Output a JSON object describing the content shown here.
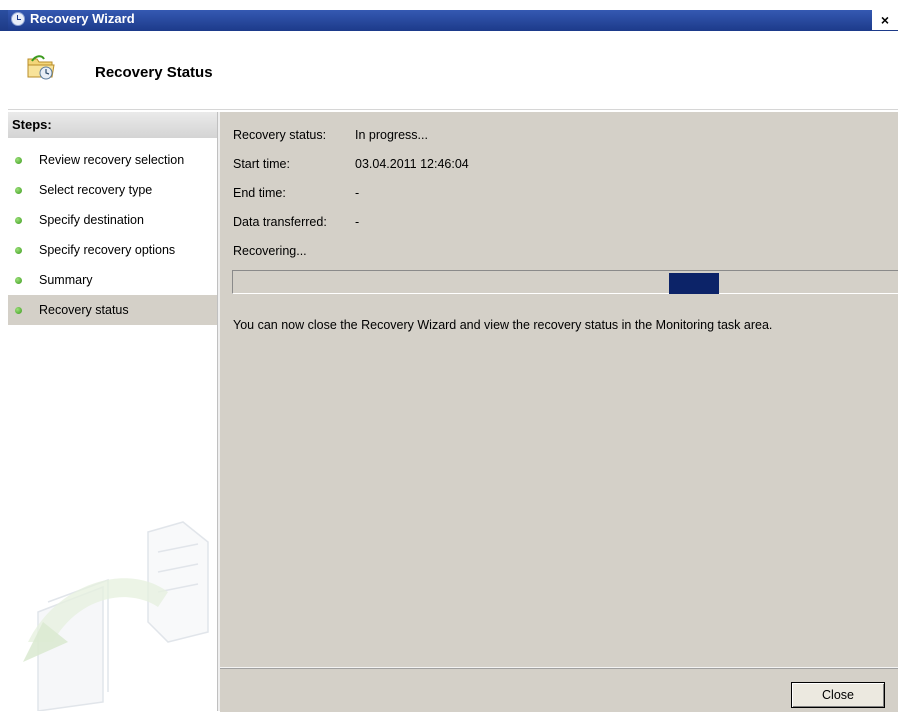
{
  "window": {
    "title": "Recovery Wizard",
    "close_glyph": "×",
    "icon": "clock-icon"
  },
  "header": {
    "title": "Recovery Status",
    "icon": "folder-recovery-icon"
  },
  "steps": {
    "heading": "Steps:",
    "items": [
      {
        "label": "Review recovery selection",
        "active": false
      },
      {
        "label": "Select recovery type",
        "active": false
      },
      {
        "label": "Specify destination",
        "active": false
      },
      {
        "label": "Specify recovery options",
        "active": false
      },
      {
        "label": "Summary",
        "active": false
      },
      {
        "label": "Recovery status",
        "active": true
      }
    ],
    "bullet_color": "#3c9a1e"
  },
  "status": {
    "recovery_status_label": "Recovery status:",
    "recovery_status_value": "In progress...",
    "start_time_label": "Start time:",
    "start_time_value": "03.04.2011 12:46:04",
    "end_time_label": "End time:",
    "end_time_value": "-",
    "data_transferred_label": "Data transferred:",
    "data_transferred_value": "-",
    "activity": "Recovering...",
    "progress_color": "#0c2368",
    "note": "You can now close the Recovery Wizard and view the recovery status in the Monitoring task area."
  },
  "footer": {
    "close_label": "Close"
  }
}
